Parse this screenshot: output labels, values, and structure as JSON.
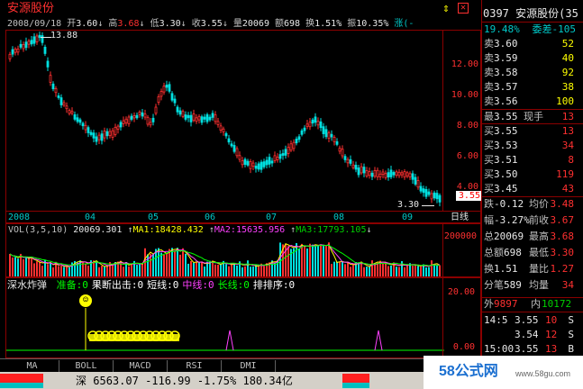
{
  "header": {
    "stock_name": "安源股份",
    "date": "2008/09/18",
    "open_label": "开",
    "open": "3.60",
    "high_label": "高",
    "high": "3.68",
    "low_label": "低",
    "low": "3.30",
    "close_label": "收",
    "close": "3.55",
    "volume_label": "量",
    "volume": "20069",
    "amount_label": "额",
    "amount": "698",
    "turnover_label": "换",
    "turnover": "1.51%",
    "amplitude_label": "振",
    "amplitude": "10.35%",
    "rise_label": "涨(-",
    "code_partial": "0397 安源股份(35",
    "up_icon": "↑",
    "down_icon": "↓"
  },
  "main_chart": {
    "price_labels": [
      "12.00",
      "10.00",
      "8.00",
      "6.00",
      "4.00"
    ],
    "high_marker": "13.88",
    "low_marker": "3.30",
    "last_price_tag": "3.55",
    "date_labels": [
      "2008",
      "04",
      "05",
      "06",
      "07",
      "08",
      "09"
    ],
    "scale_label": "日线"
  },
  "vol_chart": {
    "title": "VOL(3,5,10)",
    "value": "20069.301",
    "ma1_label": "MA1:18428.432",
    "ma2_label": "MA2:15635.956",
    "ma3_label": "MA3:17793.105",
    "axis_label": "200000"
  },
  "indicator": {
    "name": "深水炸弹",
    "items": [
      {
        "label": "准备:0",
        "color": "#00ff00"
      },
      {
        "label": "果断出击:0",
        "color": "#ffffff"
      },
      {
        "label": "短线:0",
        "color": "#ffffff"
      },
      {
        "label": "中线:0",
        "color": "#ff40ff"
      },
      {
        "label": "长线:0",
        "color": "#00ff00"
      },
      {
        "label": "排排序:0",
        "color": "#ffffff"
      }
    ],
    "axis_top": "20.00",
    "axis_bottom": "0.00"
  },
  "right_panel": {
    "ratio_label": "19.48%",
    "ratio_right": "委差-105",
    "asks": [
      {
        "label": "卖",
        "price": "3.60",
        "vol": "52"
      },
      {
        "label": "卖",
        "price": "3.59",
        "vol": "40"
      },
      {
        "label": "卖",
        "price": "3.58",
        "vol": "92"
      },
      {
        "label": "卖",
        "price": "3.57",
        "vol": "38"
      },
      {
        "label": "卖",
        "price": "3.56",
        "vol": "100"
      }
    ],
    "last_label": "最",
    "last_price": "3.55",
    "last_hand_label": "现手",
    "last_hand": "13",
    "bids": [
      {
        "label": "买",
        "price": "3.55",
        "vol": "13"
      },
      {
        "label": "买",
        "price": "3.53",
        "vol": "34"
      },
      {
        "label": "买",
        "price": "3.51",
        "vol": "8"
      },
      {
        "label": "买",
        "price": "3.50",
        "vol": "119"
      },
      {
        "label": "买",
        "price": "3.45",
        "vol": "43"
      }
    ],
    "stats": [
      {
        "l1": "跌",
        "v1": "-0.12",
        "l2": "均价",
        "v2": "3.48"
      },
      {
        "l1": "幅",
        "v1": "-3.27%",
        "l2": "前收",
        "v2": "3.67"
      },
      {
        "l1": "总",
        "v1": "20069",
        "l2": "最高",
        "v2": "3.68"
      },
      {
        "l1": "总额",
        "v1": "698",
        "l2": "最低",
        "v2": "3.30"
      },
      {
        "l1": "换",
        "v1": "1.51",
        "l2": "量比",
        "v2": "1.27"
      },
      {
        "l1": "分笔",
        "v1": "589",
        "l2": "均量",
        "v2": "34"
      }
    ],
    "outer_label": "外",
    "outer": "9897",
    "inner_label": "内",
    "inner": "10172",
    "ticks": [
      {
        "time": "14:5",
        "price": "3.55",
        "vol": "10",
        "side": "S"
      },
      {
        "time": "",
        "price": "3.54",
        "vol": "12",
        "side": "S"
      },
      {
        "time": "15:00",
        "price": "3.55",
        "vol": "13",
        "side": "B"
      }
    ]
  },
  "tabs": [
    "MA",
    "BOLL",
    "MACD",
    "RSI",
    "DMI"
  ],
  "status": {
    "market": "深",
    "index": "6563.07",
    "change": "-116.99",
    "pct": "-1.75%",
    "amount": "180.34亿",
    "watermark": "58公式网",
    "site": "www.58gu.com"
  }
}
